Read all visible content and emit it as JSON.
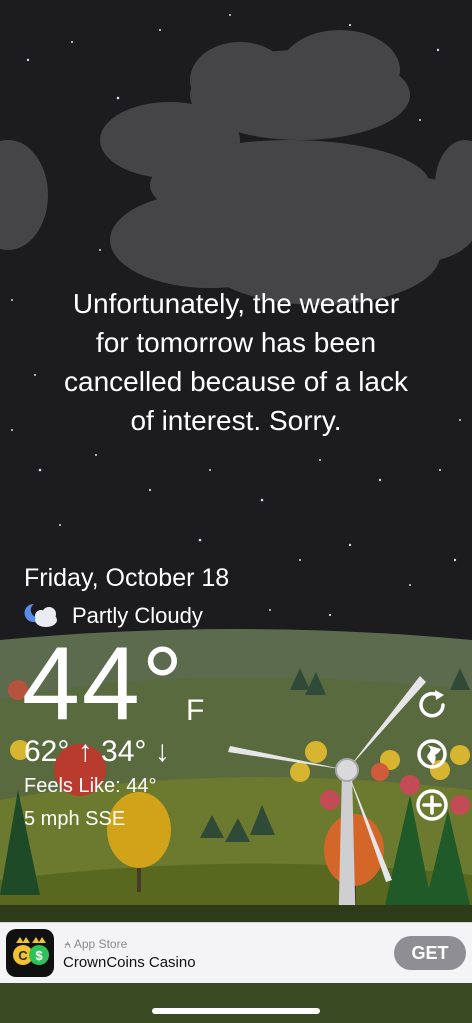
{
  "message": {
    "lines": [
      "Unfortunately, the weather",
      "for tomorrow has been",
      "cancelled because of a lack",
      "of interest. Sorry."
    ]
  },
  "weather": {
    "date": "Friday, October 18",
    "condition": "Partly Cloudy",
    "condition_icon": "partly-cloudy-night-icon",
    "temperature": "44°",
    "unit": "F",
    "high_low": "62° ↑  34° ↓",
    "feels_like": "Feels Like: 44°",
    "wind": "5 mph SSE"
  },
  "actions": {
    "icons": [
      "refresh-icon",
      "globe-icon",
      "add-icon"
    ]
  },
  "ad": {
    "store": "App Store",
    "app_name": "CrownCoins Casino",
    "cta": "GET",
    "icon": "crowncoins-logo-icon"
  },
  "colors": {
    "sky": "#1c1c1f",
    "cloud": "#4a4a4d",
    "hill": "#5c6b4a",
    "get_button": "#8e8e93"
  }
}
